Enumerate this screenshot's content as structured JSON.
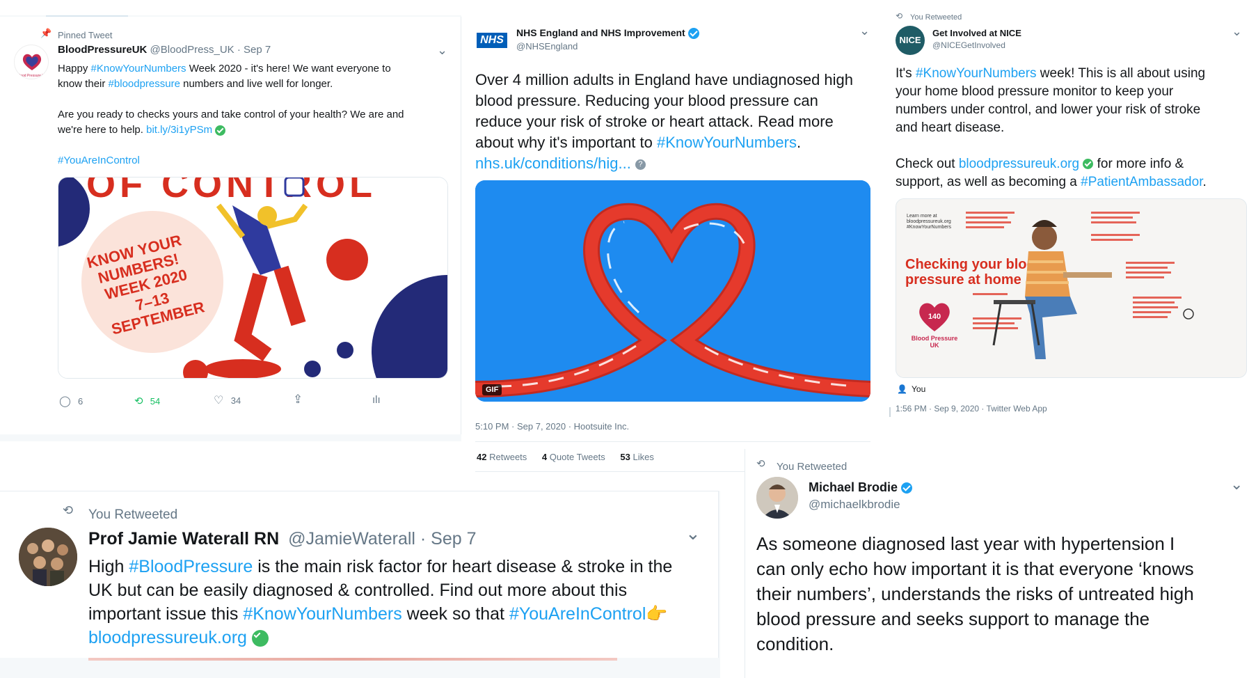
{
  "tweet1": {
    "pinned_label": "Pinned Tweet",
    "name": "BloodPressureUK",
    "handle_date": "@BloodPress_UK · Sep 7",
    "avatar_text": "Blood Pressure UK",
    "text_a1": "Happy ",
    "text_a_tag": "#KnowYourNumbers",
    "text_a2": " Week 2020 - it's here! We want everyone to",
    "text_b1": "know their ",
    "text_b_tag": "#bloodpressure",
    "text_b2": " numbers and live well for longer.",
    "text_c": "Are you ready to checks yours and take control of your health? We are and",
    "text_d1": "we're here to help. ",
    "text_d_link": "bit.ly/3i1yPSm",
    "text_e_tag": "#YouAreInControl",
    "image_heading": "OF CONTROL",
    "image_badge": "KNOW YOUR NUMBERS! WEEK 2020 7–13 SEPTEMBER",
    "image_badge_lines": [
      "KNOW YOUR",
      "NUMBERS!",
      "WEEK 2020",
      "7–13",
      "SEPTEMBER"
    ],
    "replies": "6",
    "retweets": "54",
    "likes": "34"
  },
  "tweet2": {
    "name": "NHS England and NHS Improvement",
    "handle": "@NHSEngland",
    "logo_text": "NHS",
    "line1": "Over 4 million adults in England have undiagnosed high",
    "line2": "blood pressure. Reducing your blood pressure can",
    "line3": "reduce your risk of stroke or heart attack. Read more",
    "line4a": "about why it's important to ",
    "line4_tag": "#KnowYourNumbers",
    "line4b": ".",
    "link": "nhs.uk/conditions/hig...",
    "gif_label": "GIF",
    "meta": "5:10 PM · Sep 7, 2020 · Hootsuite Inc.",
    "retweets_count": "42",
    "retweets_label": "Retweets",
    "quotes_count": "4",
    "quotes_label": "Quote Tweets",
    "likes_count": "53",
    "likes_label": "Likes"
  },
  "tweet3": {
    "retweeted_label": "You Retweeted",
    "name": "Get Involved at NICE",
    "handle": "@NICEGetInvolved",
    "avatar_text": "NICE",
    "l1a": "It's ",
    "l1_tag": "#KnowYourNumbers",
    "l1b": " week! This is all about using",
    "l2": "your home blood pressure monitor to keep your",
    "l3": "numbers under control, and lower your risk of stroke",
    "l4": "and heart disease.",
    "l5a": "Check out ",
    "l5_link": "bloodpressureuk.org",
    "l5b": " for more info &",
    "l6a": "support, as well as becoming a ",
    "l6_tag": "#PatientAmbassador",
    "l6b": ".",
    "infographic_title": "Checking your blood pressure at home",
    "infographic_title_lines": [
      "Checking your blood",
      "pressure at home"
    ],
    "infographic_small": "Learn more at bloodpressureuk.org #KnowYourNumbers",
    "infographic_small_lines": [
      "Learn more at",
      "bloodpressureuk.org",
      "#KnowYourNumbers"
    ],
    "infographic_logo": "Blood Pressure UK",
    "infographic_logo_lines": [
      "Blood Pressure",
      "UK"
    ],
    "infographic_badge": "140",
    "you_label": "You",
    "meta": "1:56 PM · Sep 9, 2020 · Twitter Web App"
  },
  "tweet4": {
    "retweeted_label": "You Retweeted",
    "name": "Prof Jamie Waterall RN",
    "handle_date": "@JamieWaterall · Sep 7",
    "l1a": "High ",
    "l1_tag": "#BloodPressure",
    "l1b": " is the main risk factor for heart disease & stroke in the",
    "l2": "UK but can be easily diagnosed & controlled. Find out more about this",
    "l3a": "important issue this ",
    "l3_tag1": "#KnowYourNumbers",
    "l3b": " week so that ",
    "l3_tag2": "#YouAreInControl",
    "l4_link": "bloodpressureuk.org"
  },
  "tweet5": {
    "retweeted_label": "You Retweeted",
    "name": "Michael Brodie",
    "handle": "@michaelkbrodie",
    "l1": "As someone diagnosed last year with hypertension I",
    "l2": "can only echo how important it is that everyone ‘knows",
    "l3": "their numbers’, understands the risks of untreated high",
    "l4": "blood pressure and seeks support to manage the",
    "l5": "condition."
  },
  "colors": {
    "twitter_blue": "#1da1f2",
    "nhs_blue": "#005eb8",
    "gif_bg": "#1e8bf0",
    "heart_red": "#e53a2c",
    "verified_green": "#3dbb61",
    "nice_teal": "#1f5c66"
  }
}
